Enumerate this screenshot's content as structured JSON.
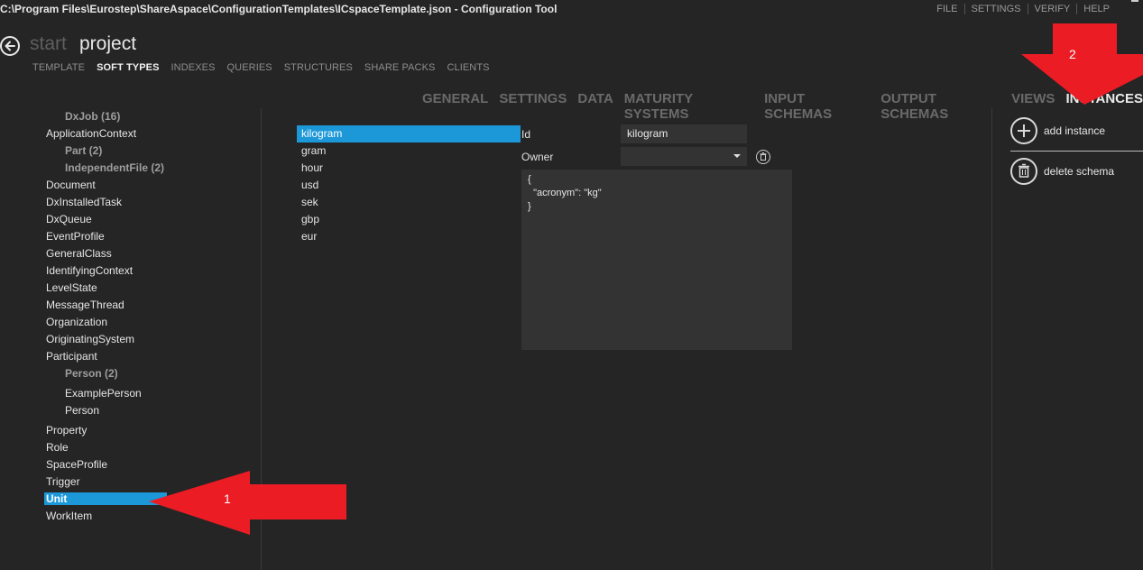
{
  "window": {
    "title": "C:\\Program Files\\Eurostep\\ShareAspace\\ConfigurationTemplates\\ICspaceTemplate.json - Configuration Tool",
    "menu": [
      "FILE",
      "SETTINGS",
      "VERIFY",
      "HELP"
    ]
  },
  "breadcrumb": {
    "start": "start",
    "project": "project"
  },
  "sub_tabs": [
    {
      "label": "TEMPLATE"
    },
    {
      "label": "SOFT TYPES",
      "active": true
    },
    {
      "label": "INDEXES"
    },
    {
      "label": "QUERIES"
    },
    {
      "label": "STRUCTURES"
    },
    {
      "label": "SHARE PACKS"
    },
    {
      "label": "CLIENTS"
    }
  ],
  "section_tabs": [
    {
      "label": "GENERAL"
    },
    {
      "label": "SETTINGS"
    },
    {
      "label": "DATA"
    },
    {
      "label": "MATURITY SYSTEMS"
    },
    {
      "label": "INPUT SCHEMAS"
    },
    {
      "label": "OUTPUT SCHEMAS"
    },
    {
      "label": "VIEWS"
    },
    {
      "label": "INSTANCES",
      "active": true
    }
  ],
  "types": [
    {
      "label": "DxJob (16)",
      "level": "child"
    },
    {
      "label": "ApplicationContext",
      "level": "root"
    },
    {
      "label": "Part (2)",
      "level": "child"
    },
    {
      "label": "IndependentFile (2)",
      "level": "child"
    },
    {
      "label": "Document",
      "level": "root"
    },
    {
      "label": "DxInstalledTask",
      "level": "root"
    },
    {
      "label": "DxQueue",
      "level": "root"
    },
    {
      "label": "EventProfile",
      "level": "root"
    },
    {
      "label": "GeneralClass",
      "level": "root"
    },
    {
      "label": "IdentifyingContext",
      "level": "root"
    },
    {
      "label": "LevelState",
      "level": "root"
    },
    {
      "label": "MessageThread",
      "level": "root"
    },
    {
      "label": "Organization",
      "level": "root"
    },
    {
      "label": "OriginatingSystem",
      "level": "root"
    },
    {
      "label": "Participant",
      "level": "root"
    },
    {
      "label": "Person (2)",
      "level": "child"
    },
    {
      "label": "ExamplePerson",
      "level": "leaf"
    },
    {
      "label": "Person",
      "level": "leaf"
    },
    {
      "label": "Property",
      "level": "root"
    },
    {
      "label": "Role",
      "level": "root"
    },
    {
      "label": "SpaceProfile",
      "level": "root"
    },
    {
      "label": "Trigger",
      "level": "root"
    },
    {
      "label": "Unit",
      "level": "root",
      "selected": true
    },
    {
      "label": "WorkItem",
      "level": "root"
    }
  ],
  "instances": [
    {
      "label": "kilogram",
      "selected": true
    },
    {
      "label": "gram"
    },
    {
      "label": "hour"
    },
    {
      "label": "usd"
    },
    {
      "label": "sek"
    },
    {
      "label": "gbp"
    },
    {
      "label": "eur"
    }
  ],
  "form": {
    "id_label": "Id",
    "id_value": "kilogram",
    "owner_label": "Owner",
    "owner_value": "",
    "json_lines": [
      "{",
      "  \"acronym\": \"kg\"",
      "}"
    ]
  },
  "actions": {
    "add": "add instance",
    "delete": "delete schema"
  },
  "annotations": [
    {
      "label": "1"
    },
    {
      "label": "2"
    }
  ],
  "colors": {
    "accent": "#1c97d8",
    "background": "#252526",
    "callout": "#ec1c24"
  }
}
